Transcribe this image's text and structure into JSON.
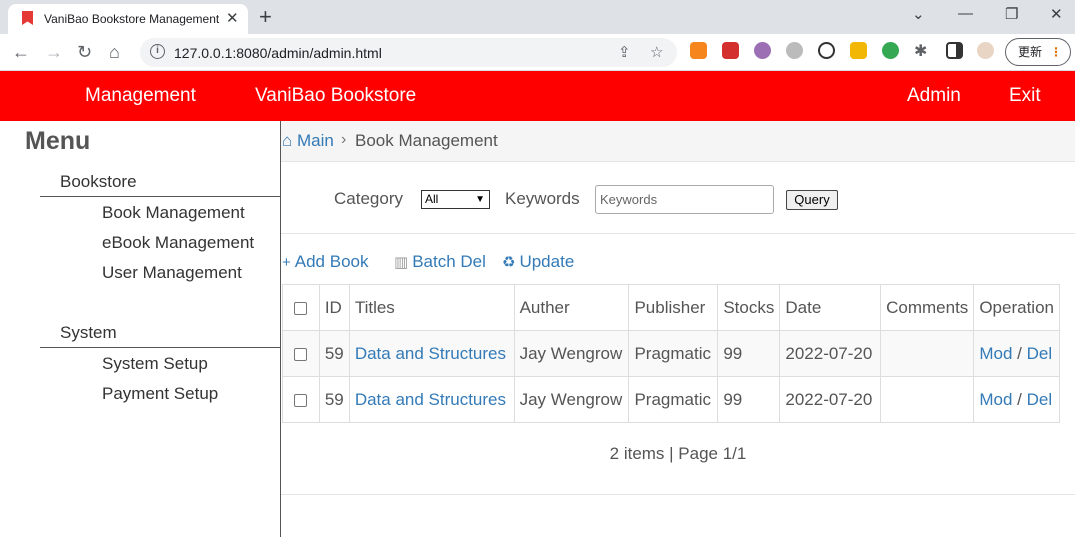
{
  "browser": {
    "tab_title": "VaniBao Bookstore Management",
    "url": "127.0.0.1:8080/admin/admin.html",
    "update_label": "更新"
  },
  "header": {
    "management": "Management",
    "brand": "VaniBao Bookstore",
    "admin": "Admin",
    "exit": "Exit",
    "bg_color": "#ff0000"
  },
  "sidebar": {
    "title": "Menu",
    "sections": [
      {
        "title": "Bookstore",
        "items": [
          "Book Management",
          "eBook Management",
          "User Management"
        ]
      },
      {
        "title": "System",
        "items": [
          "System Setup",
          "Payment Setup"
        ]
      }
    ]
  },
  "breadcrumb": {
    "home": "⌂ Main",
    "current": "Book Management"
  },
  "search": {
    "category_label": "Category",
    "category_value": "All",
    "keywords_label": "Keywords",
    "keywords_placeholder": "Keywords",
    "query_label": "Query"
  },
  "toolbar": {
    "add": "Add Book",
    "batch_del": "Batch Del",
    "update": "Update"
  },
  "table": {
    "headers": [
      "ID",
      "Titles",
      "Auther",
      "Publisher",
      "Stocks",
      "Date",
      "Comments",
      "Operation"
    ],
    "rows": [
      {
        "id": "59",
        "title": "Data and Structures",
        "author": "Jay Wengrow",
        "publisher": "Pragmatic",
        "stocks": "99",
        "date": "2022-07-20",
        "comments": "",
        "mod": "Mod",
        "sep": "/",
        "del": "Del"
      },
      {
        "id": "59",
        "title": "Data and Structures",
        "author": "Jay Wengrow",
        "publisher": "Pragmatic",
        "stocks": "99",
        "date": "2022-07-20",
        "comments": "",
        "mod": "Mod",
        "sep": "/",
        "del": "Del"
      }
    ]
  },
  "pager": "2 items | Page 1/1"
}
